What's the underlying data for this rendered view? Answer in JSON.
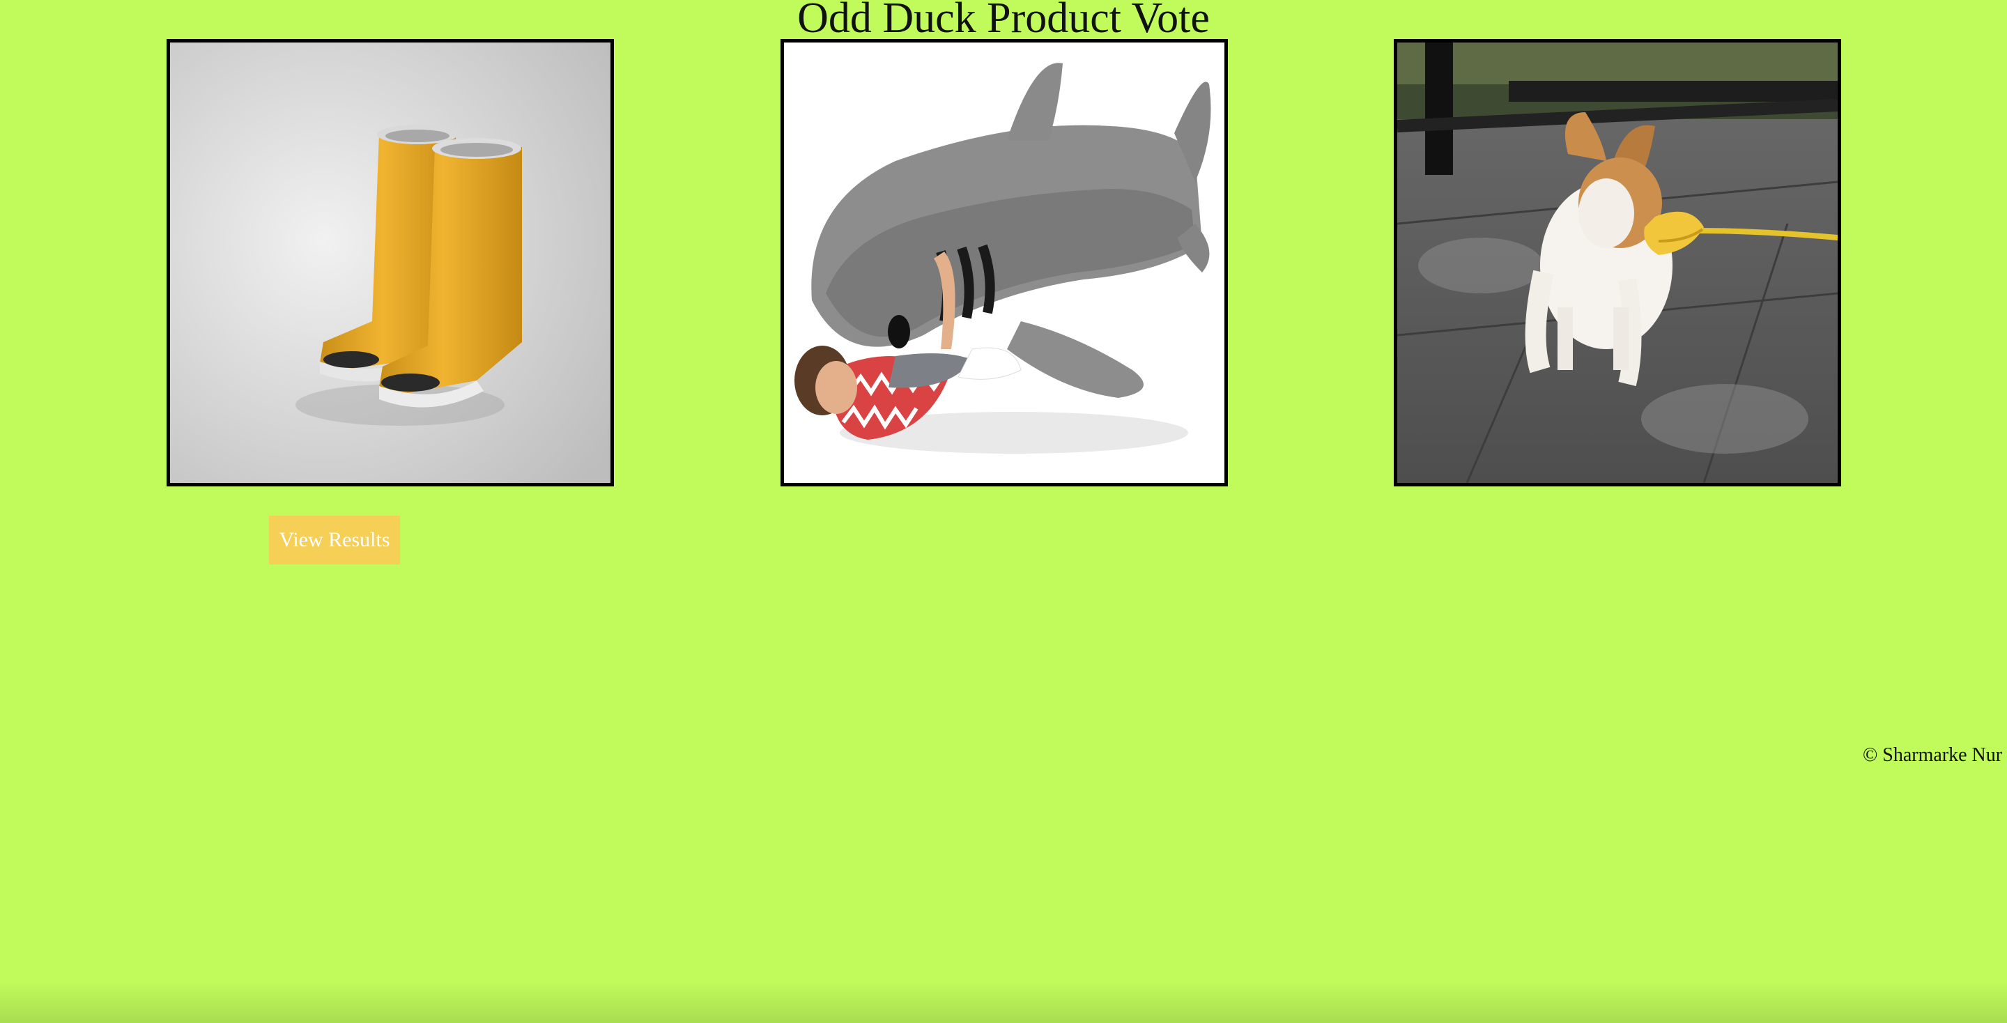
{
  "page": {
    "title": "Odd Duck Product Vote",
    "background_color": "#c0fb5b"
  },
  "products": [
    {
      "name": "boots",
      "icon": "rain-boots-image"
    },
    {
      "name": "shark",
      "icon": "shark-sleeping-bag-image"
    },
    {
      "name": "dog-duck",
      "icon": "dog-duck-muzzle-image"
    }
  ],
  "actions": {
    "view_results_label": "View Results",
    "button_color": "#f6cf57"
  },
  "footer": {
    "text": "© Sharmarke Nur"
  }
}
